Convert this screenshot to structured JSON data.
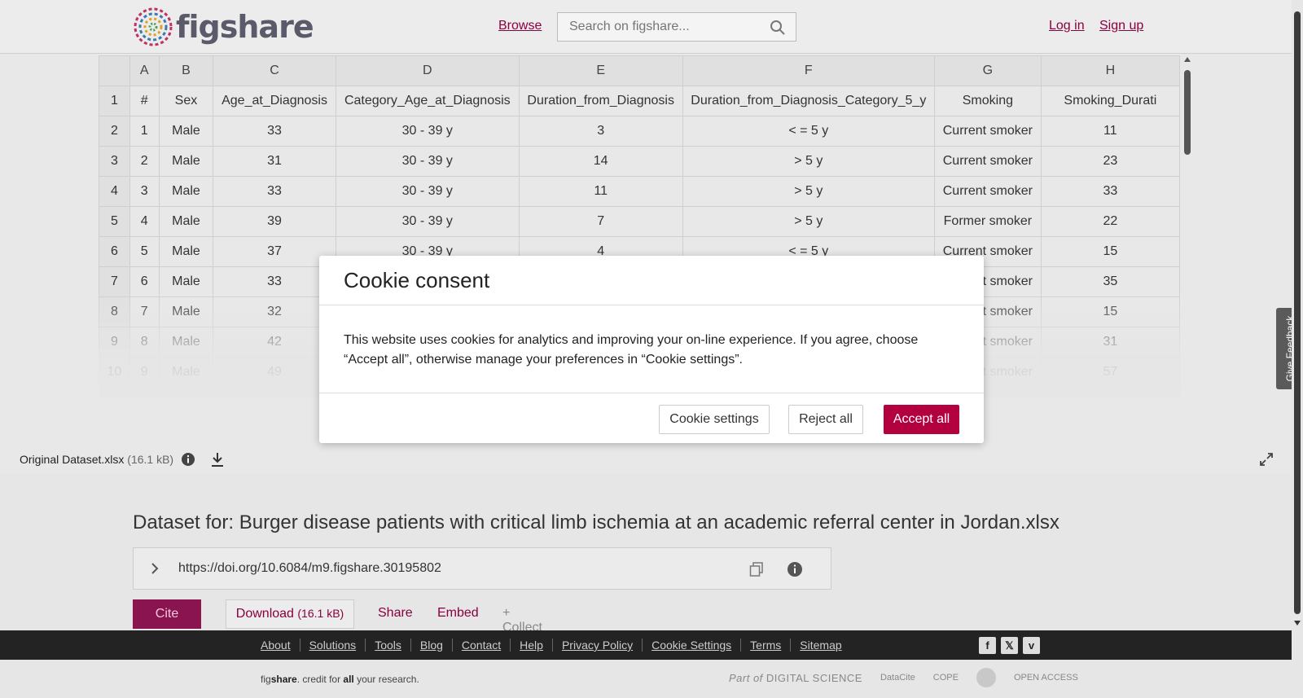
{
  "header": {
    "logo_text": "figshare",
    "browse_label": "Browse",
    "search_placeholder": "Search on figshare...",
    "login_label": "Log in",
    "signup_label": "Sign up"
  },
  "sheet": {
    "column_letters": [
      "",
      "A",
      "B",
      "C",
      "D",
      "E",
      "F",
      "G",
      "H"
    ],
    "rows": [
      [
        "1",
        "#",
        "Sex",
        "Age_at_Diagnosis",
        "Category_Age_at_Diagnosis",
        "Duration_from_Diagnosis",
        "Duration_from_Diagnosis_Category_5_y",
        "Smoking",
        "Smoking_Durati"
      ],
      [
        "2",
        "1",
        "Male",
        "33",
        "30 - 39 y",
        "3",
        "< = 5 y",
        "Current smoker",
        "11"
      ],
      [
        "3",
        "2",
        "Male",
        "31",
        "30 - 39 y",
        "14",
        "> 5 y",
        "Current smoker",
        "23"
      ],
      [
        "4",
        "3",
        "Male",
        "33",
        "30 - 39 y",
        "11",
        "> 5 y",
        "Current smoker",
        "33"
      ],
      [
        "5",
        "4",
        "Male",
        "39",
        "30 - 39 y",
        "7",
        "> 5 y",
        "Former smoker",
        "22"
      ],
      [
        "6",
        "5",
        "Male",
        "37",
        "30 - 39 y",
        "4",
        "< = 5 y",
        "Current smoker",
        "15"
      ],
      [
        "7",
        "6",
        "Male",
        "33",
        "",
        "",
        "",
        "Current smoker",
        "35"
      ],
      [
        "8",
        "7",
        "Male",
        "32",
        "",
        "",
        "",
        "Current smoker",
        "15"
      ],
      [
        "9",
        "8",
        "Male",
        "42",
        "",
        "",
        "",
        "Current smoker",
        "31"
      ],
      [
        "10",
        "9",
        "Male",
        "49",
        "",
        "",
        "",
        "Current smoker",
        "57"
      ]
    ]
  },
  "file_bar": {
    "file_name": "Original Dataset.xlsx",
    "file_size": "(16.1 kB)"
  },
  "feedback_label": "Give Feedback",
  "article": {
    "title": "Dataset for: Burger disease patients with critical limb ischemia at an academic referral center in Jordan.xlsx",
    "doi": "https://doi.org/10.6084/m9.figshare.30195802",
    "cite_label": "Cite",
    "download_label": "Download",
    "download_size": "(16.1 kB)",
    "share_label": "Share",
    "embed_label": "Embed",
    "collect_label": "+ Collect"
  },
  "footer": {
    "links": [
      "About",
      "Solutions",
      "Tools",
      "Blog",
      "Contact",
      "Help",
      "Privacy Policy",
      "Cookie Settings",
      "Terms",
      "Sitemap"
    ],
    "tagline_fig": "fig",
    "tagline_share": "share",
    "tagline_mid": ". credit for ",
    "tagline_all": "all",
    "tagline_end": " your research.",
    "partner_part_of": "Part of",
    "partner_digital_science": "DIGITAL SCIENCE",
    "partner_datacite": "DataCite",
    "partner_cope": "COPE",
    "partner_open_access": "OPEN ACCESS"
  },
  "cookie_modal": {
    "title": "Cookie consent",
    "body": "This website uses cookies for analytics and improving your on-line experience. If you agree, choose “Accept all”, otherwise manage your preferences in “Cookie settings”.",
    "settings_label": "Cookie settings",
    "reject_label": "Reject all",
    "accept_label": "Accept all"
  },
  "colors": {
    "brand": "#8a0040",
    "accept": "#b3003f",
    "footer_bg": "#232323"
  }
}
